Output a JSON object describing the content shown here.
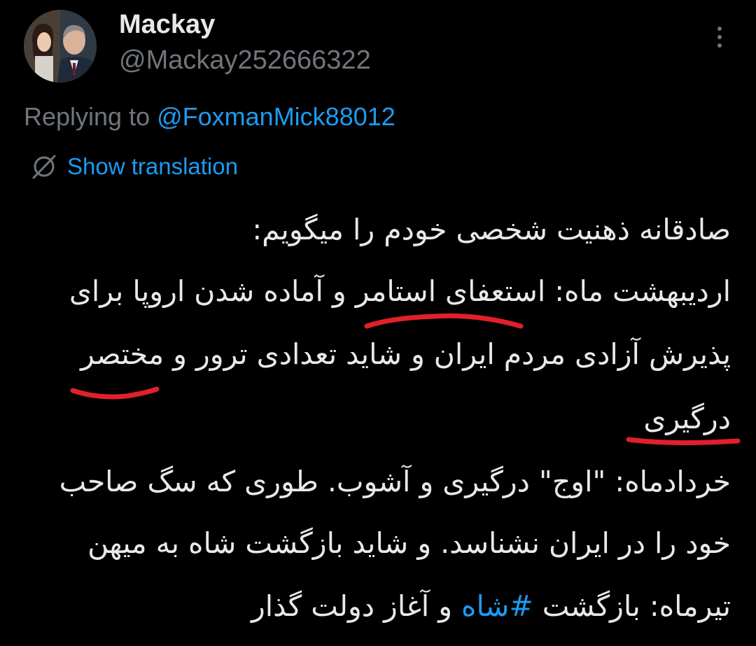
{
  "author": {
    "display_name": "Mackay",
    "handle": "@Mackay252666322"
  },
  "reply": {
    "prefix": "Replying to ",
    "target_handle": "@FoxmanMick88012"
  },
  "translation": {
    "label": "Show translation",
    "icon": "globe-slash-icon"
  },
  "tweet": {
    "lines": [
      "صادقانه ذهنیت شخصی خودم را میگویم:",
      "اردیبهشت ماه: استعفای استامر و آماده شدن اروپا برای",
      "پذیرش آزادی مردم ایران و شاید تعدادی ترور و مختصر",
      "درگیری",
      "خردادماه: \"اوج\" درگیری و آشوب. طوری که سگ صاحب",
      "خود را در ایران نشناسد. و شاید بازگشت شاه به میهن"
    ],
    "last_line_before": "تیرماه: بازگشت ",
    "hashtag": "#شاه",
    "last_line_after": " و آغاز دولت گذار"
  },
  "colors": {
    "background": "#000000",
    "text": "#e7e9ea",
    "muted": "#71767b",
    "link": "#1d9bf0",
    "annotation": "#e0202a"
  }
}
